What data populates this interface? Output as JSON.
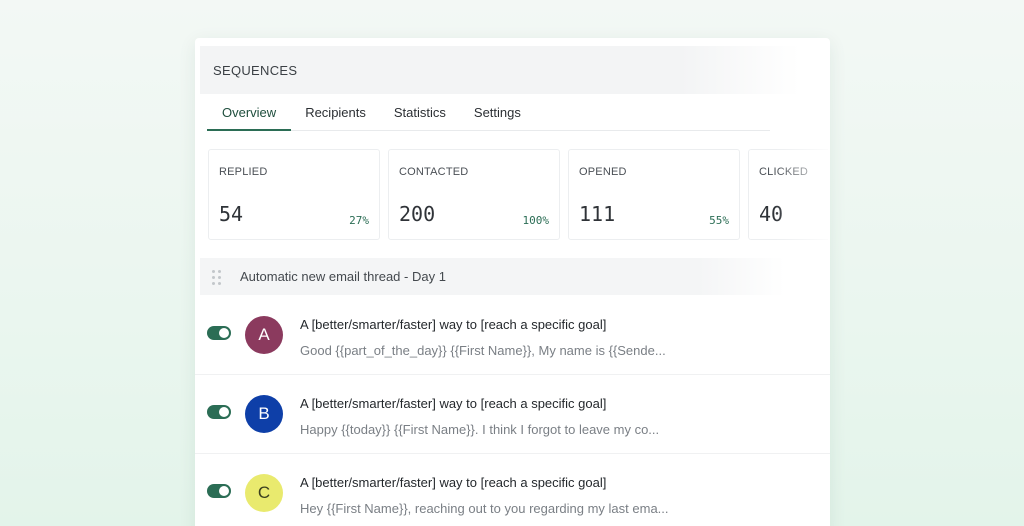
{
  "header": {
    "title": "SEQUENCES"
  },
  "tabs": [
    {
      "label": "Overview",
      "active": true
    },
    {
      "label": "Recipients",
      "active": false
    },
    {
      "label": "Statistics",
      "active": false
    },
    {
      "label": "Settings",
      "active": false
    }
  ],
  "stats": [
    {
      "label": "REPLIED",
      "value": "54",
      "percent": "27%"
    },
    {
      "label": "CONTACTED",
      "value": "200",
      "percent": "100%"
    },
    {
      "label": "OPENED",
      "value": "111",
      "percent": "55%"
    },
    {
      "label": "CLICKED",
      "value": "40"
    }
  ],
  "step": {
    "title": "Automatic new email thread - Day 1",
    "icon": "drag-handle-icon"
  },
  "emails": [
    {
      "avatar": "A",
      "avatar_color": "#8b3a5e",
      "subject": "A [better/smarter/faster] way to [reach a specific goal]",
      "preview": "Good {{part_of_the_day}} {{First Name}}, My name is {{Sende...",
      "enabled": true
    },
    {
      "avatar": "B",
      "avatar_color": "#0e3fa8",
      "subject": "A [better/smarter/faster] way to [reach a specific goal]",
      "preview": "Happy {{today}} {{First Name}}. I think I forgot to leave my co...",
      "enabled": true
    },
    {
      "avatar": "C",
      "avatar_color": "#e9ea6e",
      "subject": "A [better/smarter/faster] way to [reach a specific goal]",
      "preview": "Hey {{First Name}}, reaching out to you regarding my last ema...",
      "enabled": true
    }
  ],
  "colors": {
    "accent": "#2b6d55",
    "toggle_on": "#2b6d55"
  }
}
